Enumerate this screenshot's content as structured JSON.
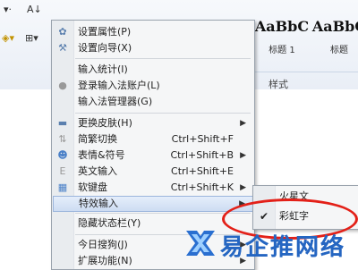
{
  "ribbon": {
    "tools_top": "A↓",
    "styles": [
      {
        "sample": "AaBbC",
        "caption": "标题 1"
      },
      {
        "sample": "AaBbC",
        "caption": "标题 2"
      },
      {
        "sample": "AaBbC",
        "caption": "标题"
      }
    ],
    "group_label": "样式"
  },
  "menu": {
    "items": [
      {
        "label": "设置属性(P)",
        "shortcut": "",
        "submenu": false,
        "icon": "settings-icon"
      },
      {
        "label": "设置向导(X)",
        "shortcut": "",
        "submenu": false,
        "icon": "wrench-icon"
      },
      {
        "label": "输入统计(I)",
        "shortcut": "",
        "submenu": false,
        "icon": ""
      },
      {
        "label": "登录输入法账户(L)",
        "shortcut": "",
        "submenu": false,
        "icon": "account-icon"
      },
      {
        "label": "输入法管理器(G)",
        "shortcut": "",
        "submenu": false,
        "icon": ""
      },
      {
        "label": "更换皮肤(H)",
        "shortcut": "",
        "submenu": true,
        "icon": "skin-icon"
      },
      {
        "label": "简繁切换",
        "shortcut": "Ctrl+Shift+F",
        "submenu": false,
        "icon": "switch-icon"
      },
      {
        "label": "表情&符号",
        "shortcut": "Ctrl+Shift+B",
        "submenu": true,
        "icon": "emoji-icon"
      },
      {
        "label": "英文输入",
        "shortcut": "Ctrl+Shift+E",
        "submenu": false,
        "icon": "english-icon"
      },
      {
        "label": "软键盘",
        "shortcut": "Ctrl+Shift+K",
        "submenu": true,
        "icon": "keyboard-icon"
      },
      {
        "label": "特效输入",
        "shortcut": "",
        "submenu": true,
        "icon": ""
      },
      {
        "label": "隐藏状态栏(Y)",
        "shortcut": "",
        "submenu": false,
        "icon": ""
      },
      {
        "label": "今日搜狗(J)",
        "shortcut": "",
        "submenu": true,
        "icon": ""
      },
      {
        "label": "扩展功能(N)",
        "shortcut": "",
        "submenu": true,
        "icon": ""
      }
    ]
  },
  "submenu": {
    "items": [
      {
        "label": "火星文",
        "checked": false
      },
      {
        "label": "彩虹字",
        "checked": true
      }
    ]
  },
  "watermark": {
    "text": "易企推网络"
  },
  "colors": {
    "highlight_ring": "#e32018",
    "watermark": "#2566c2"
  }
}
